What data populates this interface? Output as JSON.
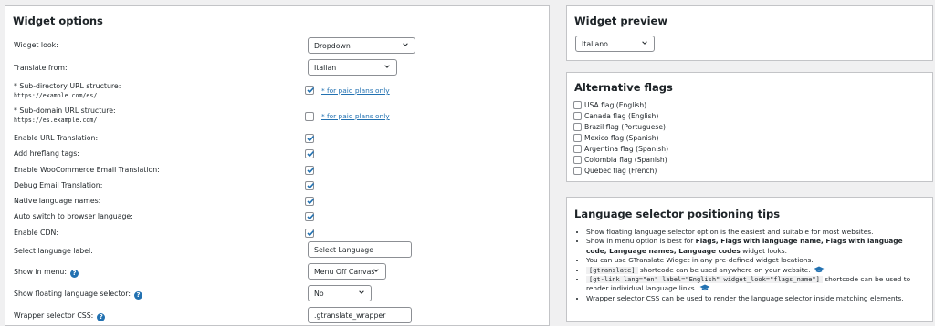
{
  "widget_options": {
    "title": "Widget options",
    "widget_look": {
      "label": "Widget look:",
      "value": "Dropdown"
    },
    "translate_from": {
      "label": "Translate from:",
      "value": "Italian"
    },
    "subdir": {
      "label": "* Sub-directory URL structure:",
      "code": "https://example.com/es/",
      "checked": true,
      "link": "* for paid plans only"
    },
    "subdomain": {
      "label": "* Sub-domain URL structure:",
      "code": "https://es.example.com/",
      "checked": false,
      "link": "* for paid plans only"
    },
    "checkbox_rows": [
      {
        "label": "Enable URL Translation:",
        "checked": true
      },
      {
        "label": "Add hreflang tags:",
        "checked": true
      },
      {
        "label": "Enable WooCommerce Email Translation:",
        "checked": true
      },
      {
        "label": "Debug Email Translation:",
        "checked": true
      },
      {
        "label": "Native language names:",
        "checked": true
      },
      {
        "label": "Auto switch to browser language:",
        "checked": true
      },
      {
        "label": "Enable CDN:",
        "checked": true
      }
    ],
    "select_language_label": {
      "label": "Select language label:",
      "value": "Select Language"
    },
    "show_in_menu": {
      "label": "Show in menu:",
      "value": "Menu Off Canvas"
    },
    "show_floating": {
      "label": "Show floating language selector:",
      "value": "No"
    },
    "wrapper_css": {
      "label": "Wrapper selector CSS:",
      "value": ".gtranslate_wrapper"
    }
  },
  "widget_preview": {
    "title": "Widget preview",
    "selected": "Italiano"
  },
  "alternative_flags": {
    "title": "Alternative flags",
    "items": [
      "USA flag (English)",
      "Canada flag (English)",
      "Brazil flag (Portuguese)",
      "Mexico flag (Spanish)",
      "Argentina flag (Spanish)",
      "Colombia flag (Spanish)",
      "Quebec flag (French)"
    ]
  },
  "tips": {
    "title": "Language selector positioning tips",
    "t1": "Show floating language selector option is the easiest and suitable for most websites.",
    "t2a": "Show in menu option is best for ",
    "t2b": "Flags, Flags with language name, Flags with language code, Language names, Language codes",
    "t2c": " widget looks.",
    "t3": "You can use GTranslate Widget in any pre-defined widget locations.",
    "t4code": "[gtranslate]",
    "t4text": " shortcode can be used anywhere on your website.",
    "t5code": "[gt-link lang=\"en\" label=\"English\" widget_look=\"flags_name\"]",
    "t5text": " shortcode can be used to render individual language links.",
    "t6": "Wrapper selector CSS can be used to render the language selector inside matching elements."
  },
  "colors": {
    "accent": "#2271b1",
    "panel_border": "#c3c4c7",
    "background": "#f0f0f1"
  }
}
